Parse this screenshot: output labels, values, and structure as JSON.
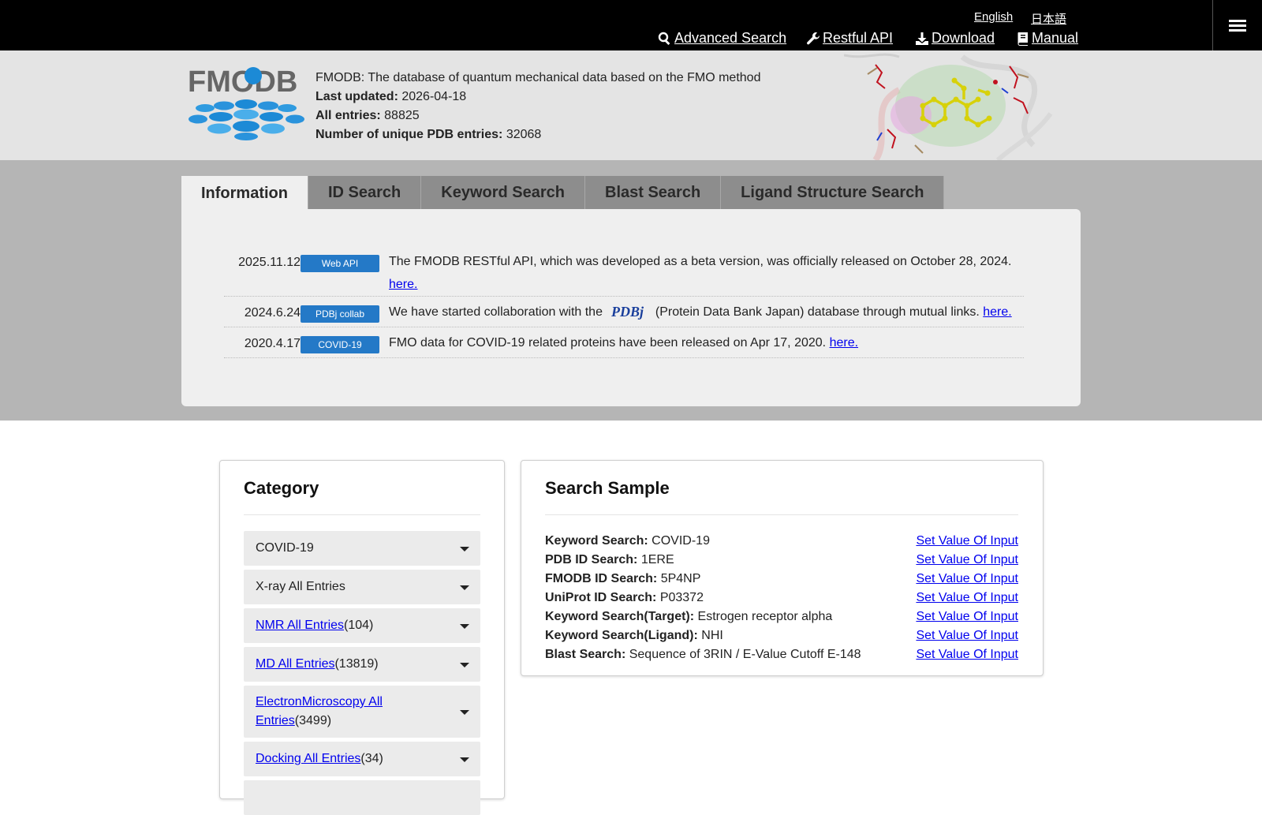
{
  "topbar": {
    "lang_en": "English",
    "lang_ja": "日本語",
    "nav": {
      "advanced_search": "Advanced Search",
      "restful_api": "Restful API",
      "download": "Download",
      "manual": "Manual"
    }
  },
  "header": {
    "logo_text": "FMODB",
    "description": "FMODB: The database of quantum mechanical data based on the FMO method",
    "last_updated_label": "Last updated:",
    "last_updated_value": "2026-04-18",
    "all_entries_label": "All entries:",
    "all_entries_value": "88825",
    "unique_pdb_label": "Number of unique PDB entries:",
    "unique_pdb_value": "32068"
  },
  "tabs": [
    {
      "label": "Information",
      "active": true
    },
    {
      "label": "ID Search",
      "active": false
    },
    {
      "label": "Keyword Search",
      "active": false
    },
    {
      "label": "Blast Search",
      "active": false
    },
    {
      "label": "Ligand Structure Search",
      "active": false
    }
  ],
  "news": [
    {
      "date": "2025.11.12",
      "badge": "Web API",
      "text": "The FMODB RESTful API, which was developed as a beta version, was officially released on October 28, 2024.",
      "link": "here."
    },
    {
      "date": "2024.6.24",
      "badge": "PDBj collab",
      "text_before": "We have started collaboration with the",
      "logo": "PDBj",
      "text_after": "(Protein Data Bank Japan) database through mutual links.",
      "link": "here."
    },
    {
      "date": "2020.4.17",
      "badge": "COVID-19",
      "text": "FMO data for COVID-19 related proteins have been released on Apr 17, 2020.",
      "link": "here."
    }
  ],
  "category": {
    "title": "Category",
    "items": [
      {
        "name": "COVID-19",
        "count": "",
        "linked": false
      },
      {
        "name": "X-ray All Entries",
        "count": "",
        "linked": false
      },
      {
        "name": "NMR All Entries",
        "count": "(104)",
        "linked": true
      },
      {
        "name": "MD All Entries",
        "count": "(13819)",
        "linked": true
      },
      {
        "name_line1": "ElectronMicroscopy All",
        "name_line2": "Entries",
        "count": "(3499)",
        "linked": true
      },
      {
        "name": "Docking All Entries",
        "count": "(34)",
        "linked": true
      }
    ]
  },
  "search_sample": {
    "title": "Search Sample",
    "action_label": "Set Value Of Input",
    "rows": [
      {
        "label": "Keyword Search:",
        "value": "COVID-19"
      },
      {
        "label": "PDB ID Search:",
        "value": "1ERE"
      },
      {
        "label": "FMODB ID Search:",
        "value": "5P4NP"
      },
      {
        "label": "UniProt ID Search:",
        "value": "P03372"
      },
      {
        "label": "Keyword Search(Target):",
        "value": "Estrogen receptor alpha"
      },
      {
        "label": "Keyword Search(Ligand):",
        "value": "NHI"
      },
      {
        "label": "Blast Search:",
        "value": "Sequence of 3RIN / E-Value Cutoff E-148"
      }
    ]
  },
  "colors": {
    "topbar_bg": "#000000",
    "header_bg": "#e4e4e4",
    "tabband_bg": "#b5b5b5",
    "badge_blue": "#2479c7",
    "link_blue": "#0000ee"
  }
}
